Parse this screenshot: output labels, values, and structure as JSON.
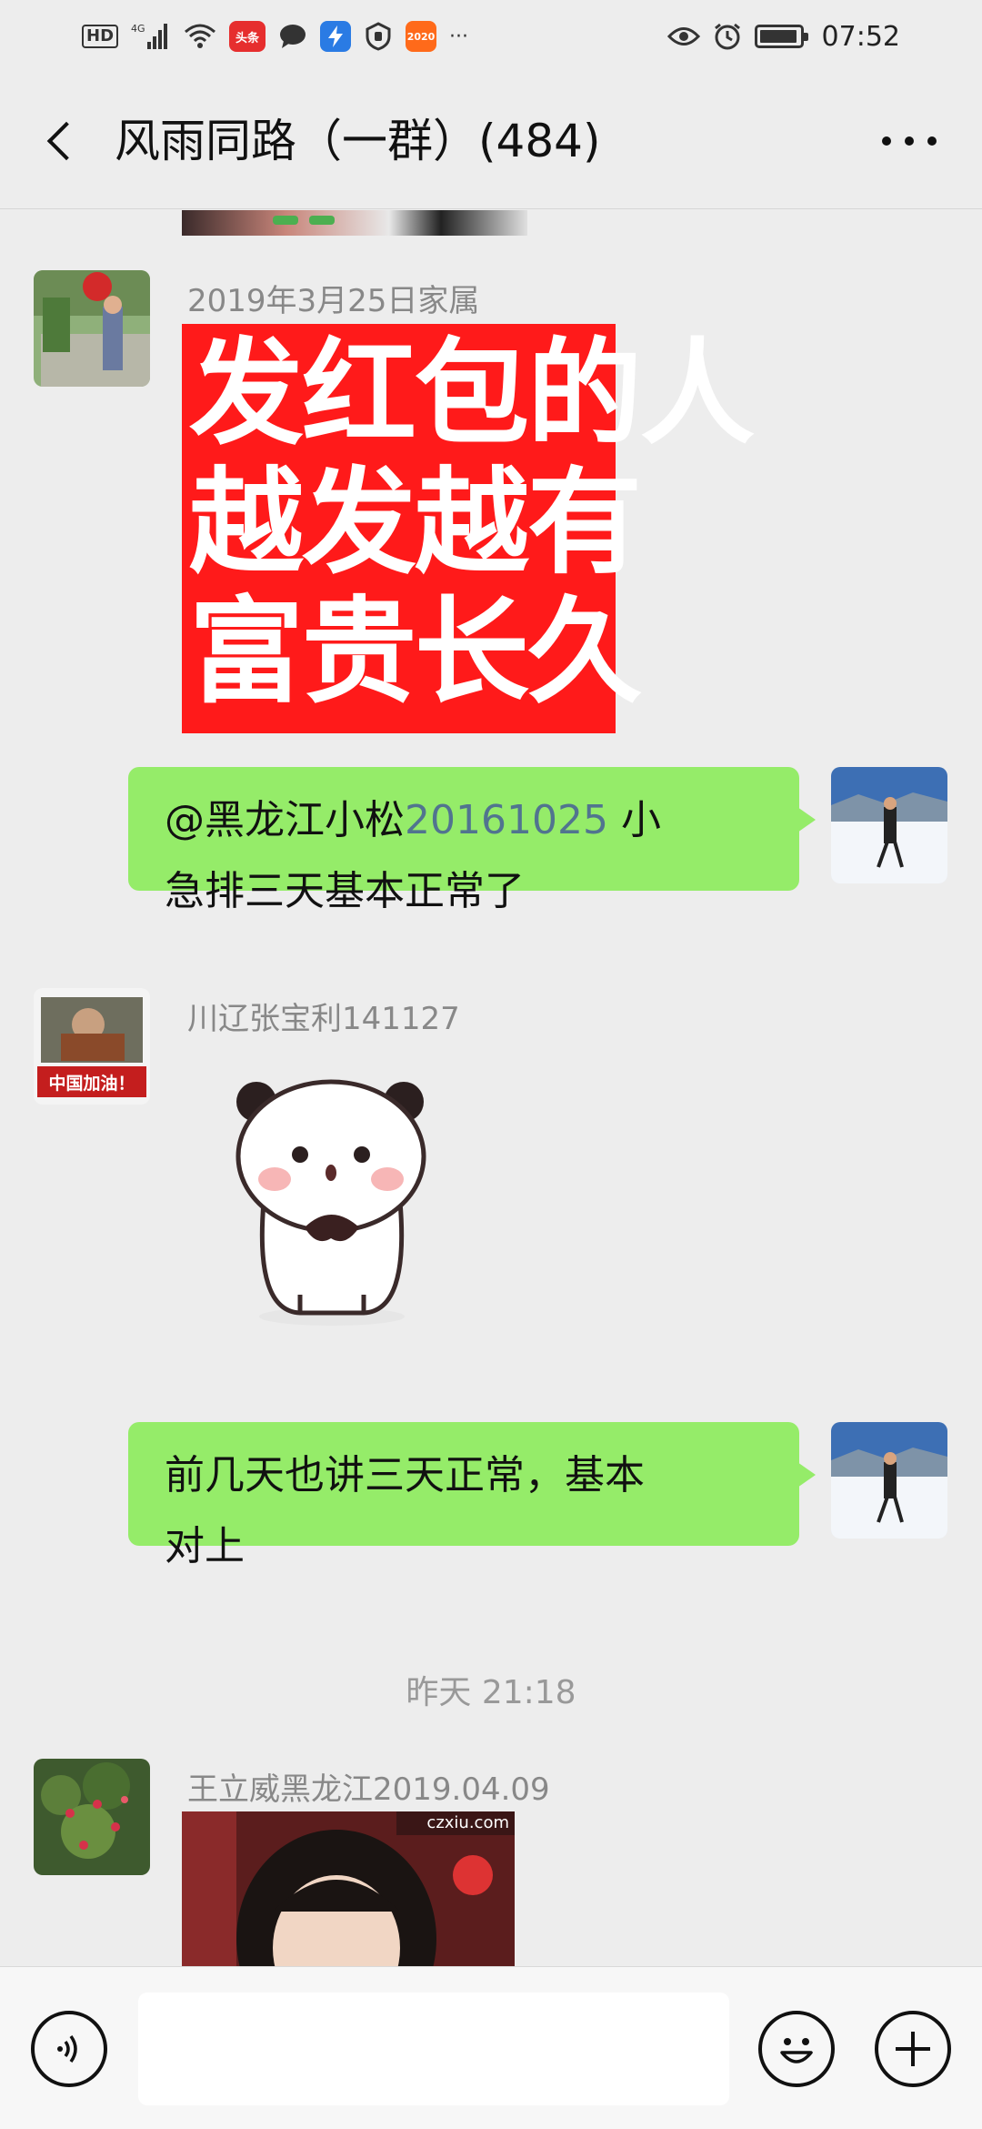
{
  "status_bar": {
    "hd": "HD",
    "network": "4G",
    "badge_toutiao": "头条",
    "badge_app": "2020",
    "more": "···",
    "time": "07:52"
  },
  "header": {
    "title": "风雨同路（一群）(484)"
  },
  "messages": [
    {
      "sender": "2019年3月25日家属",
      "image_text": [
        "发红包的人",
        "越发越有",
        "富贵长久"
      ]
    },
    {
      "mention": "@黑龙江小松",
      "mention_id": "20161025",
      "text_line1_tail": " 小",
      "text_line2": "急排三天基本正常了"
    },
    {
      "sender": "川辽张宝利141127",
      "avatar_caption": "中国加油！"
    },
    {
      "text_line1": "前几天也讲三天正常，基本",
      "text_line2": "对上"
    },
    {
      "timestamp": "昨天 21:18"
    },
    {
      "sender": "王立威黑龙江2019.04.09",
      "image_watermark": "czxiu.com"
    }
  ],
  "input_bar": {
    "placeholder": ""
  },
  "colors": {
    "background": "#ededed",
    "my_bubble": "#95ec69",
    "red_packet": "#ff1a1a",
    "mention_id": "#51748f"
  }
}
